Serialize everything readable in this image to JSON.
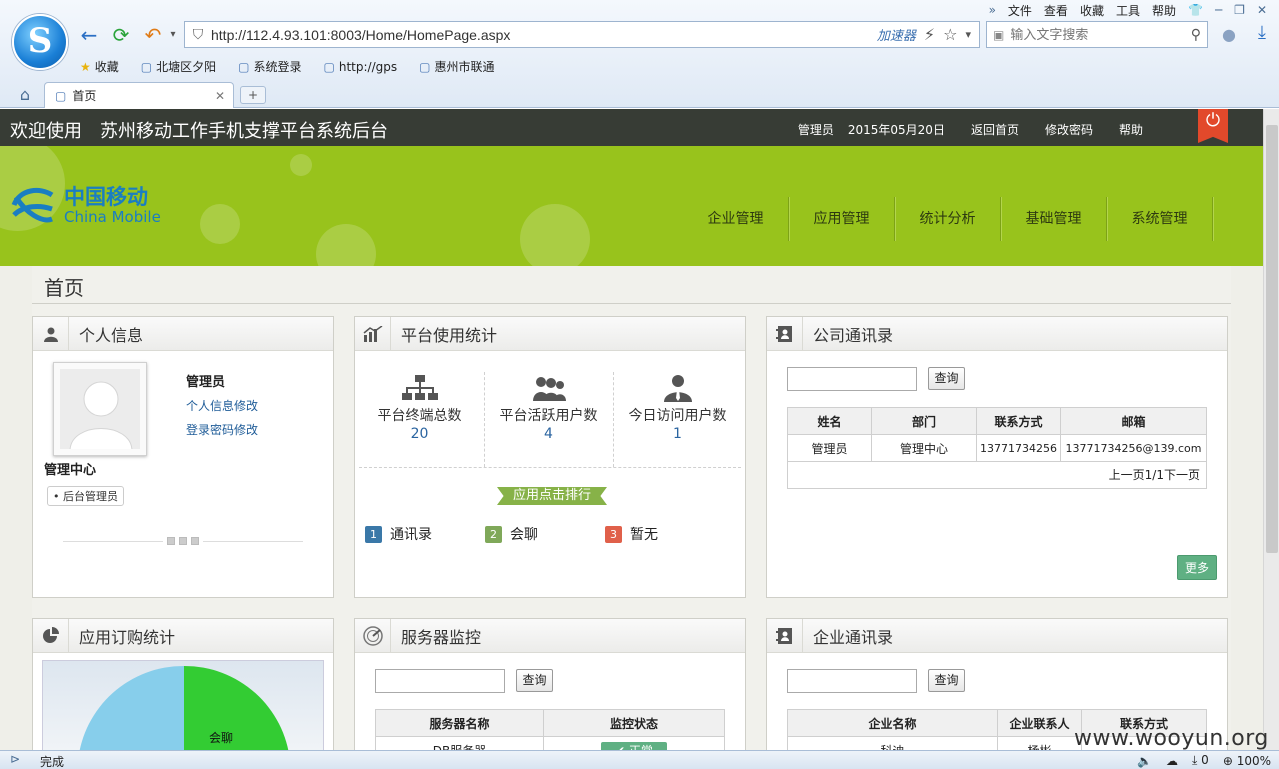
{
  "browser": {
    "menu": [
      "文件",
      "查看",
      "收藏",
      "工具",
      "帮助"
    ],
    "url": "http://112.4.93.101:8003/Home/HomePage.aspx",
    "accelerator": "加速器",
    "search_placeholder": "输入文字搜索",
    "bookmarks": [
      "收藏",
      "北塘区夕阳",
      "系统登录",
      "http://gps",
      "惠州市联通"
    ],
    "tab_title": "首页",
    "status_text": "完成",
    "status_count": "0",
    "zoom": "100%"
  },
  "topbar": {
    "welcome": "欢迎使用　苏州移动工作手机支撑平台系统后台",
    "user": "管理员",
    "date": "2015年05月20日",
    "links": [
      "返回首页",
      "修改密码",
      "帮助"
    ]
  },
  "logo": {
    "cn": "中国移动",
    "en": "China Mobile"
  },
  "nav": [
    "企业管理",
    "应用管理",
    "统计分析",
    "基础管理",
    "系统管理"
  ],
  "page_title": "首页",
  "personal": {
    "title": "个人信息",
    "name": "管理员",
    "link1": "个人信息修改",
    "link2": "登录密码修改",
    "center": "管理中心",
    "role": "后台管理员"
  },
  "stats": {
    "title": "平台使用统计",
    "items": [
      {
        "label": "平台终端总数",
        "value": "20"
      },
      {
        "label": "平台活跃用户数",
        "value": "4"
      },
      {
        "label": "今日访问用户数",
        "value": "1"
      }
    ],
    "rank_title": "应用点击排行",
    "ranking": [
      {
        "num": "1",
        "name": "通讯录",
        "color": "#3a78a8"
      },
      {
        "num": "2",
        "name": "会聊",
        "color": "#7fa859"
      },
      {
        "num": "3",
        "name": "暂无",
        "color": "#e0604a"
      }
    ]
  },
  "company_contacts": {
    "title": "公司通讯录",
    "query": "查询",
    "headers": [
      "姓名",
      "部门",
      "联系方式",
      "邮箱"
    ],
    "rows": [
      [
        "管理员",
        "管理中心",
        "13771734256",
        "13771734256@139.com"
      ]
    ],
    "pager": "上一页1/1下一页",
    "more": "更多"
  },
  "subscription": {
    "title": "应用订购统计",
    "slice_label": "会聊",
    "colors": {
      "a": "#33cc33",
      "b": "#87ceeb"
    }
  },
  "server": {
    "title": "服务器监控",
    "query": "查询",
    "headers": [
      "服务器名称",
      "监控状态"
    ],
    "row_name": "DB服务器",
    "row_status": "正常"
  },
  "enterprise_contacts": {
    "title": "企业通讯录",
    "query": "查询",
    "headers": [
      "企业名称",
      "企业联系人",
      "联系方式"
    ],
    "row": [
      "科迪",
      "杨彬",
      ""
    ]
  },
  "watermark": "www.wooyun.org"
}
